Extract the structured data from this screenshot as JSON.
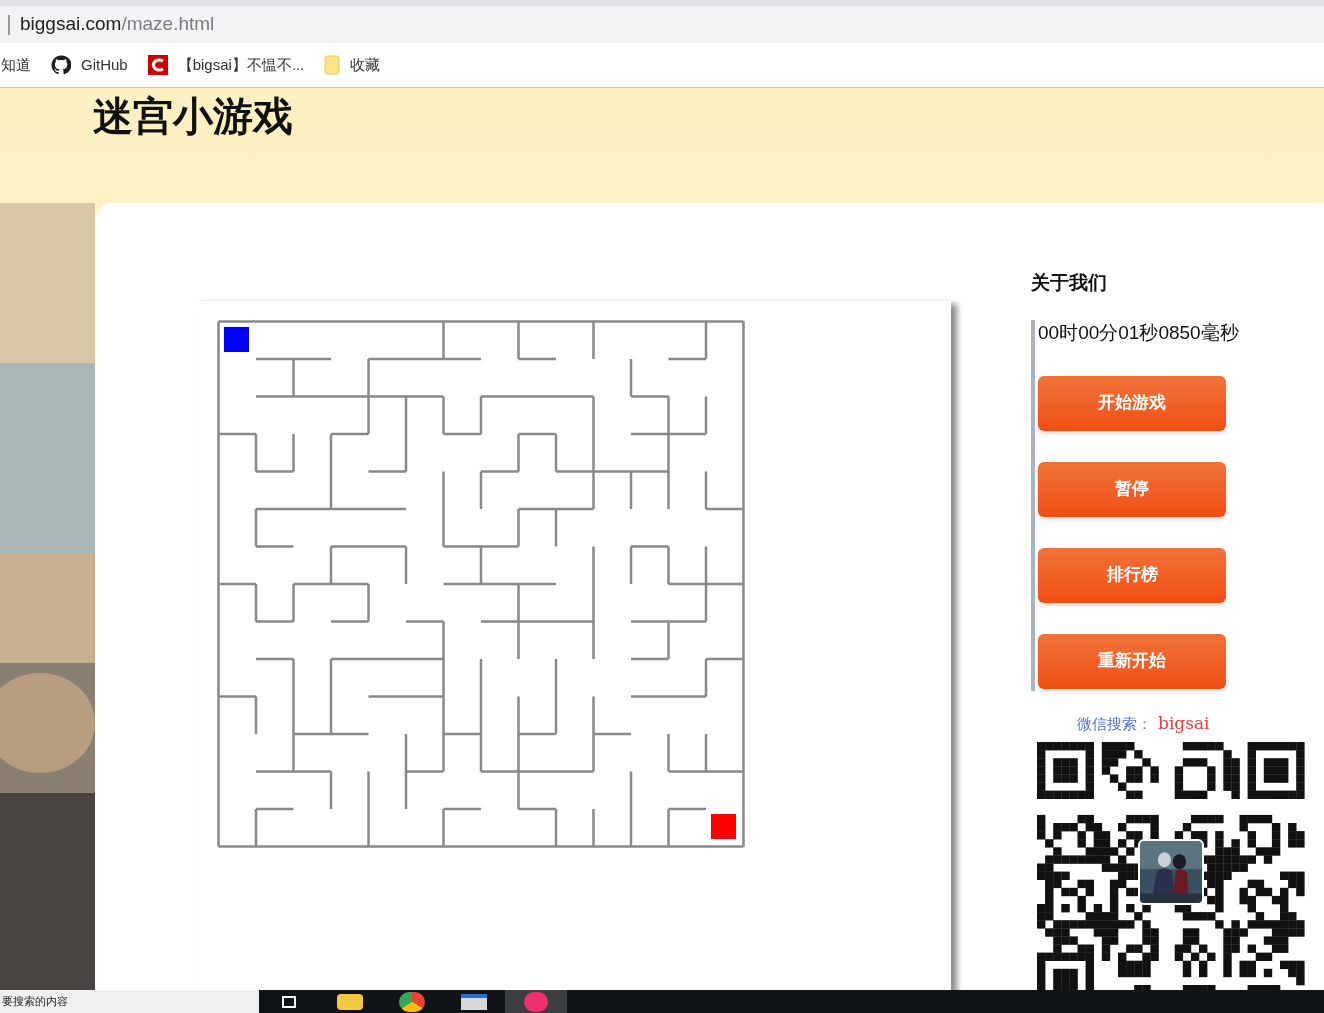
{
  "browser": {
    "url_host": "biggsai.com",
    "url_path": "/maze.html",
    "bookmarks": [
      {
        "label": "知道",
        "kind": "site"
      },
      {
        "label": "GitHub",
        "kind": "github"
      },
      {
        "label": "【bigsai】不愠不...",
        "kind": "blog"
      },
      {
        "label": "收藏",
        "kind": "folder"
      }
    ]
  },
  "page": {
    "title": "迷宫小游戏",
    "sidebar": {
      "heading": "关于我们",
      "timer": "00时00分01秒0850毫秒",
      "buttons": [
        "开始游戏",
        "暂停",
        "排行榜",
        "重新开始"
      ],
      "wechat_label": "微信搜索：",
      "wechat_id": "bigsai"
    }
  },
  "taskbar": {
    "search_placeholder": "要搜索的内容"
  }
}
